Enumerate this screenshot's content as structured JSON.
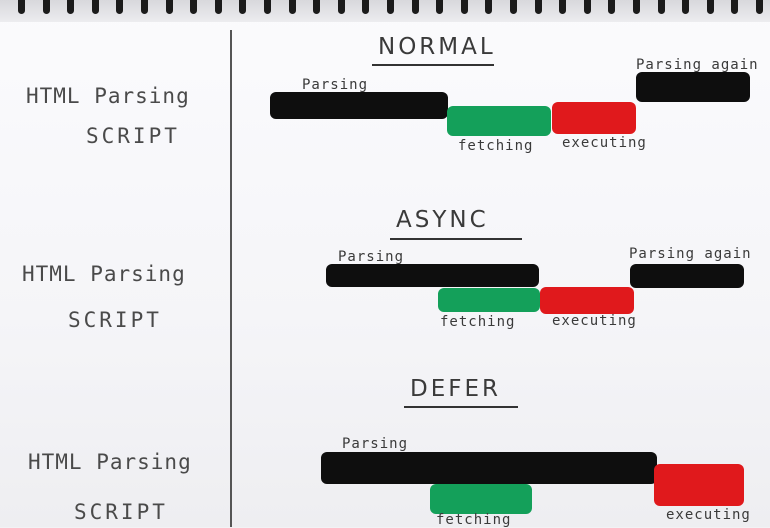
{
  "row_labels": {
    "html": "HTML Parsing",
    "script": "SCRIPT"
  },
  "bar_labels": {
    "parsing": "Parsing",
    "parsing_again": "Parsing again",
    "fetching": "fetching",
    "executing": "executing"
  },
  "colors": {
    "parsing": "#0e0e0e",
    "fetching": "#14a05a",
    "executing": "#e0191c"
  },
  "sections": [
    {
      "title": "NORMAL"
    },
    {
      "title": "ASYNC"
    },
    {
      "title": "DEFER"
    }
  ]
}
